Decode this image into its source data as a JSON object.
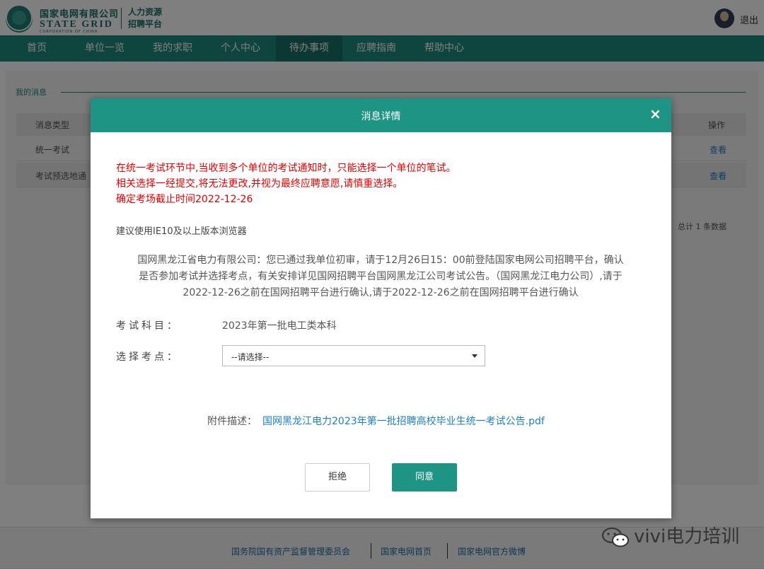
{
  "header": {
    "corp_cn": "国家电网有限公司",
    "corp_en": "STATE GRID",
    "corp_en_sub": "CORPORATION OF CHINA",
    "system_line1": "人力资源",
    "system_line2": "招聘平台",
    "logout_label": "退出"
  },
  "nav": {
    "items": [
      "首页",
      "单位一览",
      "我的求职",
      "个人中心",
      "待办事项",
      "应聘指南",
      "帮助中心"
    ],
    "active_index": 4
  },
  "content": {
    "section_title": "我的消息",
    "table": {
      "headers": [
        "消息类型",
        "操作"
      ],
      "rows": [
        {
          "type": "统一考试",
          "action": "查看"
        },
        {
          "type": "考试预选地通",
          "action": "查看"
        }
      ]
    },
    "total_text": "总计 1 条数据"
  },
  "modal": {
    "title": "消息详情",
    "close_glyph": "×",
    "warnings": [
      "在统一考试环节中,当收到多个单位的考试通知时，只能选择一个单位的笔试。",
      "相关选择一经提交,将无法更改,并视为最终应聘意愿,请慎重选择。",
      "确定考场截止时间2022-12-26"
    ],
    "browser_tip": "建议使用IE10及以上版本浏览器",
    "notice": "国网黑龙江省电力有限公司：您已通过我单位初审，请于12月26日15：00前登陆国家电网公司招聘平台，确认是否参加考试并选择考点，有关安排详见国网招聘平台国网黑龙江公司考试公告。（国网黑龙江电力公司）,请于2022-12-26之前在国网招聘平台进行确认,请于2022-12-26之前在国网招聘平台进行确认",
    "subject_label": "考试科目：",
    "subject_value": "2023年第一批电工类本科",
    "site_label": "选择考点：",
    "site_select_value": "--请选择--",
    "attachment_label": "附件描述：",
    "attachment_link": "国网黑龙江电力2023年第一批招聘高校毕业生统一考试公告.pdf",
    "reject_label": "拒绝",
    "agree_label": "同意",
    "accent_color": "#1d9484"
  },
  "footer": {
    "links": [
      "国务院国有资产监督管理委员会",
      "国家电网首页",
      "国家电网官方微博"
    ]
  },
  "watermark": {
    "text": "vivi电力培训",
    "icon": "wechat-icon"
  }
}
